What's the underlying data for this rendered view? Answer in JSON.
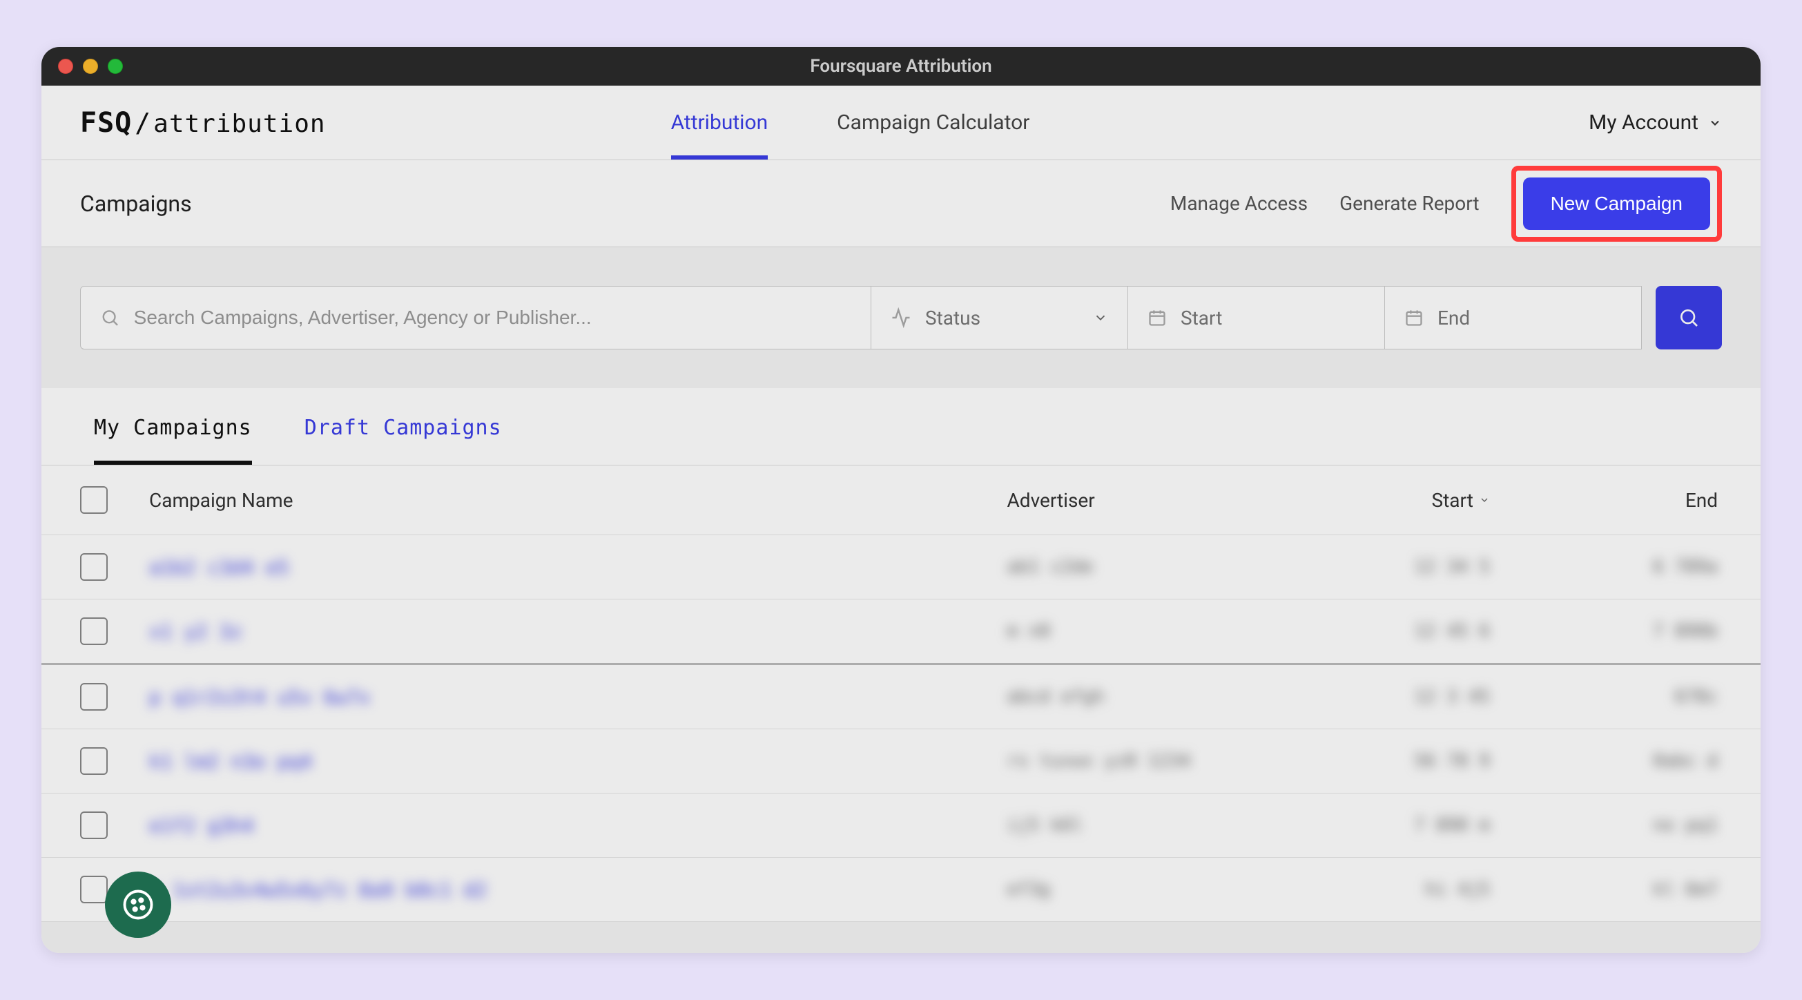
{
  "window": {
    "title": "Foursquare Attribution"
  },
  "logo": {
    "main": "FSQ",
    "slash": "/",
    "sub": "attribution"
  },
  "nav": {
    "tabs": [
      {
        "label": "Attribution",
        "active": true
      },
      {
        "label": "Campaign Calculator",
        "active": false
      }
    ],
    "account_label": "My Account"
  },
  "subheader": {
    "title": "Campaigns",
    "manage_access": "Manage Access",
    "generate_report": "Generate Report",
    "new_campaign": "New Campaign"
  },
  "filters": {
    "search_placeholder": "Search Campaigns, Advertiser, Agency or Publisher...",
    "status_label": "Status",
    "start_label": "Start",
    "end_label": "End"
  },
  "tabs2": [
    {
      "label": "My Campaigns",
      "active": true
    },
    {
      "label": "Draft Campaigns",
      "active": false
    }
  ],
  "columns": {
    "name": "Campaign Name",
    "advertiser": "Advertiser",
    "start": "Start",
    "end": "End"
  },
  "rows": [
    {
      "name": "a1b2 c3d4 e5",
      "advertiser": "ab1 c2de",
      "start": "12 34 5",
      "end": "6 789a"
    },
    {
      "name": "x1 y2 3z",
      "advertiser": "m n0",
      "start": "12 45 6",
      "end": "7 890b"
    },
    {
      "name": "p q1r2s3t4 u5v 6w7x",
      "advertiser": "abcd efgh",
      "start": "12 3 45",
      "end": "678c"
    },
    {
      "name": "k1 lm2 n3o pq4",
      "advertiser": "rs tuvwx yz0 1234",
      "start": "56 78 9",
      "end": "0abc d"
    },
    {
      "name": "e1f2 g3h4",
      "advertiser": "ij5 k6l",
      "start": "7 890 m",
      "end": "no pq1"
    },
    {
      "name": "r 1st2u3v4w5x6y7z 8a9 b0c1 d2",
      "advertiser": "ef3g",
      "start": "hi 4j5",
      "end": "kl 6m7"
    }
  ],
  "colors": {
    "primary": "#3a3de8",
    "highlight": "#ff3b3b",
    "fab": "#1d6b4e"
  }
}
